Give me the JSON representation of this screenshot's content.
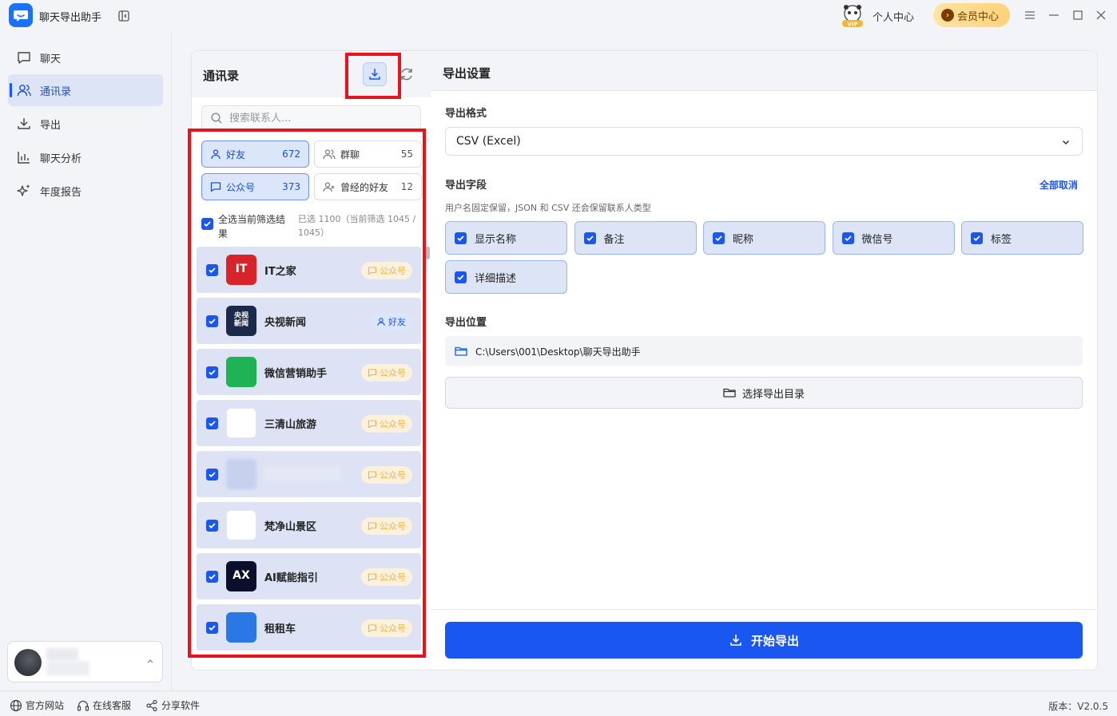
{
  "app": {
    "title": "聊天导出助手",
    "personal_center": "个人中心",
    "vip_center": "会员中心",
    "vip_badge": "VIP"
  },
  "sidebar": {
    "items": [
      {
        "label": "聊天",
        "icon": "chat-bubble-icon"
      },
      {
        "label": "通讯录",
        "icon": "contacts-icon"
      },
      {
        "label": "导出",
        "icon": "download-icon"
      },
      {
        "label": "聊天分析",
        "icon": "bar-chart-icon"
      },
      {
        "label": "年度报告",
        "icon": "sparkle-icon"
      }
    ],
    "active": "通讯录"
  },
  "footer": {
    "website": "官方网站",
    "support": "在线客服",
    "share": "分享软件",
    "version": "版本：V2.0.5"
  },
  "contacts": {
    "title": "通讯录",
    "search_placeholder": "搜索联系人...",
    "filters": [
      {
        "label": "好友",
        "count": "672",
        "active": true,
        "icon": "user-icon"
      },
      {
        "label": "群聊",
        "count": "55",
        "active": false,
        "icon": "group-icon"
      },
      {
        "label": "公众号",
        "count": "373",
        "active": true,
        "icon": "message-square-icon"
      },
      {
        "label": "曾经的好友",
        "count": "12",
        "active": false,
        "icon": "user-x-icon"
      }
    ],
    "select_all_label": "全选当前筛选结果",
    "select_summary": "已选 1100（当前筛选 1045 / 1045）",
    "items": [
      {
        "name": "IT之家",
        "tag": "公众号",
        "avatar_text": "IT",
        "avatar_color": "#d9232b"
      },
      {
        "name": "央视新闻",
        "tag": "好友",
        "avatar_text": "央视新闻",
        "avatar_color": "#1b2a4a"
      },
      {
        "name": "微信营销助手",
        "tag": "公众号",
        "avatar_text": "",
        "avatar_color": "#1fb355"
      },
      {
        "name": "三清山旅游",
        "tag": "公众号",
        "avatar_text": "",
        "avatar_color": "#ffffff"
      },
      {
        "name": "",
        "tag": "公众号",
        "avatar_text": "",
        "avatar_color": "#c6d0ef"
      },
      {
        "name": "梵净山景区",
        "tag": "公众号",
        "avatar_text": "",
        "avatar_color": "#ffffff"
      },
      {
        "name": "AI赋能指引",
        "tag": "公众号",
        "avatar_text": "AX",
        "avatar_color": "#0c0f2b"
      },
      {
        "name": "租租车",
        "tag": "公众号",
        "avatar_text": "",
        "avatar_color": "#2a78e6"
      }
    ]
  },
  "settings": {
    "title": "导出设置",
    "format_label": "导出格式",
    "format_value": "CSV (Excel)",
    "fields_label": "导出字段",
    "deselect_all": "全部取消",
    "fields_hint": "用户名固定保留，JSON 和 CSV 还会保留联系人类型",
    "fields": [
      "显示名称",
      "备注",
      "昵称",
      "微信号",
      "标签",
      "详细描述"
    ],
    "location_label": "导出位置",
    "path": "C:\\Users\\001\\Desktop\\聊天导出助手",
    "choose_dir": "选择导出目录",
    "export_button": "开始导出"
  },
  "colors": {
    "accent": "#1a56f0",
    "highlight": "#e8141c",
    "tag_gzh": "#f0b24a"
  }
}
